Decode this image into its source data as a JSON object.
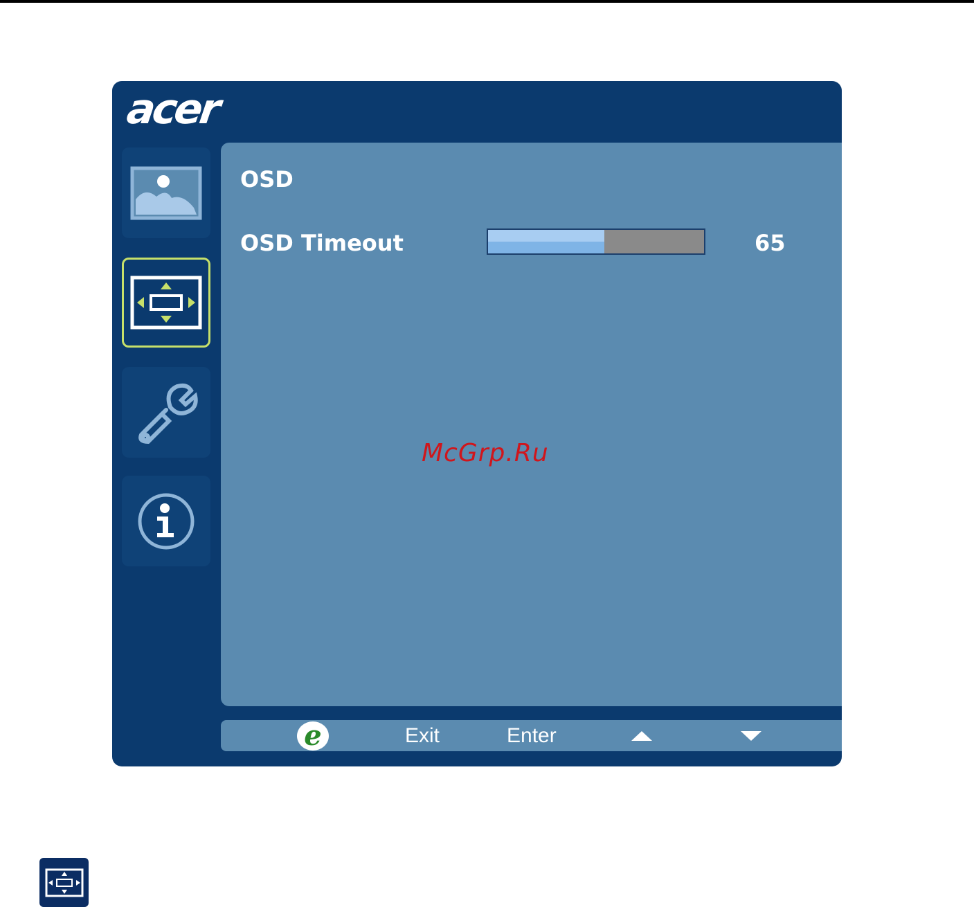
{
  "brand": {
    "name": "acer"
  },
  "sidebar": {
    "tabs": [
      {
        "name": "picture",
        "icon": "picture-icon",
        "active": false
      },
      {
        "name": "osd",
        "icon": "osd-position-icon",
        "active": true
      },
      {
        "name": "settings",
        "icon": "wrench-icon",
        "active": false
      },
      {
        "name": "information",
        "icon": "info-icon",
        "active": false
      }
    ]
  },
  "panel": {
    "title": "OSD",
    "settings": [
      {
        "label": "OSD Timeout",
        "value": "65",
        "slider_fraction": 0.54
      }
    ]
  },
  "watermark": "McGrp.Ru",
  "button_bar": {
    "e_label": "e",
    "exit_label": "Exit",
    "enter_label": "Enter",
    "up_icon": "arrow-up-icon",
    "down_icon": "arrow-down-icon"
  },
  "colors": {
    "window_bg": "#0b3a6e",
    "panel_bg": "#5b8bb0",
    "active_tab_border": "#c7e06a",
    "slider_fill": "#7fb4e6",
    "slider_track": "#8a8a8a"
  }
}
